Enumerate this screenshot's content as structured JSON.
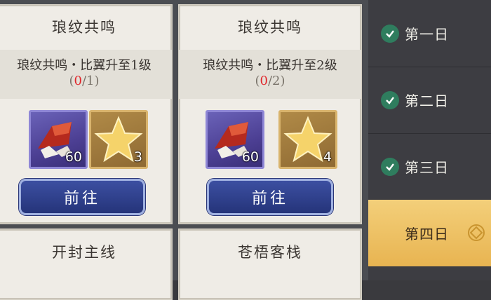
{
  "cards": [
    {
      "title": "琅纹共鸣",
      "desc_line": "琅纹共鸣・比翼升至1级",
      "progress_open": "(",
      "progress_cur": "0",
      "progress_rest": "/1)",
      "items": [
        {
          "icon": "crystal-icon",
          "count": "60"
        },
        {
          "icon": "star-icon",
          "count": "3"
        }
      ],
      "button": "前往"
    },
    {
      "title": "琅纹共鸣",
      "desc_line": "琅纹共鸣・比翼升至2级",
      "progress_open": "(",
      "progress_cur": "0",
      "progress_rest": "/2)",
      "items": [
        {
          "icon": "crystal-icon",
          "count": "60"
        },
        {
          "icon": "star-icon",
          "count": "4"
        }
      ],
      "button": "前往"
    },
    {
      "title": "开封主线"
    },
    {
      "title": "苍梧客栈"
    }
  ],
  "sidebar": {
    "tabs": [
      {
        "label": "第一日",
        "done": true
      },
      {
        "label": "第二日",
        "done": true
      },
      {
        "label": "第三日",
        "done": true
      },
      {
        "label": "第四日",
        "done": false,
        "active": true
      }
    ]
  }
}
